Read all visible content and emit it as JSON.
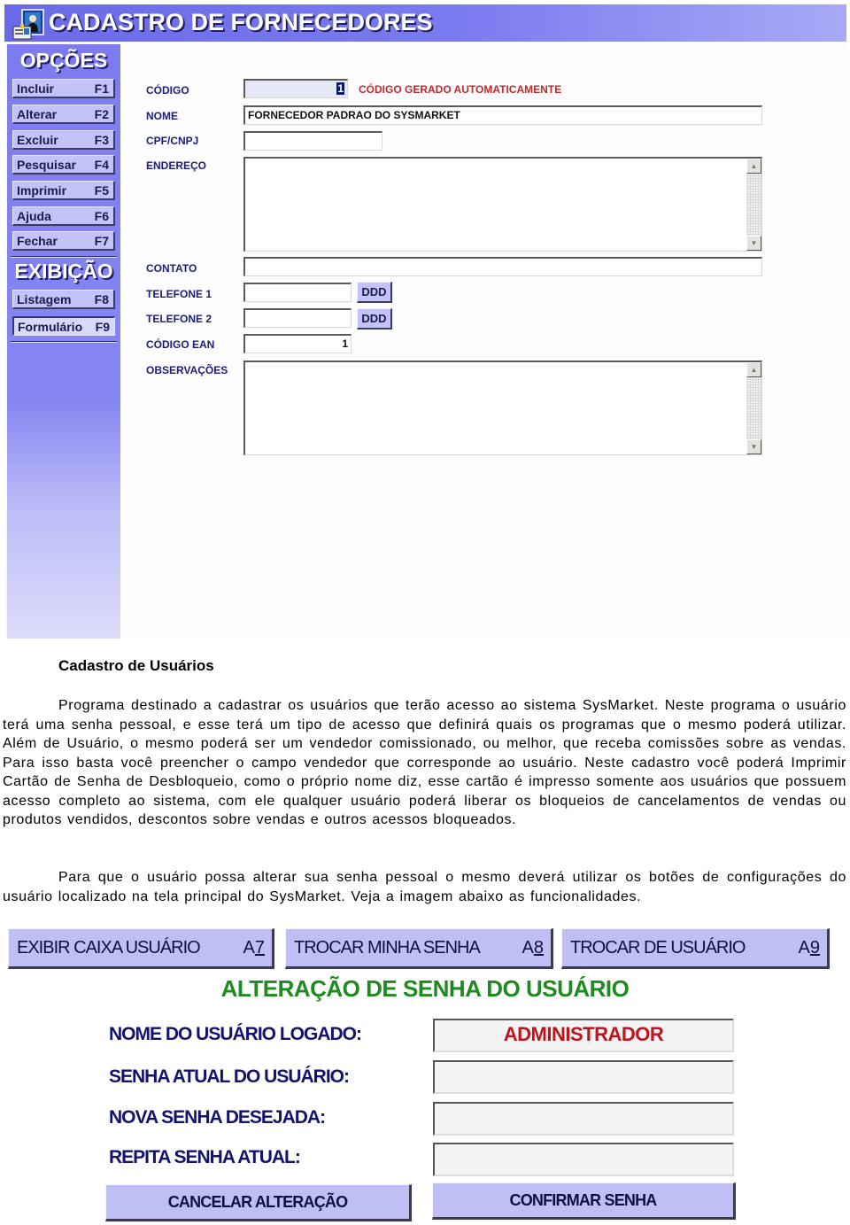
{
  "supplier_form": {
    "title": "CADASTRO DE FORNECEDORES",
    "title_icon": "user-card-icon",
    "sidebar": {
      "options_heading": "OPÇÕES",
      "options": [
        {
          "label": "Incluir",
          "key": "F1"
        },
        {
          "label": "Alterar",
          "key": "F2"
        },
        {
          "label": "Excluir",
          "key": "F3"
        },
        {
          "label": "Pesquisar",
          "key": "F4"
        },
        {
          "label": "Imprimir",
          "key": "F5"
        },
        {
          "label": "Ajuda",
          "key": "F6"
        },
        {
          "label": "Fechar",
          "key": "F7"
        }
      ],
      "display_heading": "EXIBIÇÃO",
      "display": [
        {
          "label": "Listagem",
          "key": "F8"
        },
        {
          "label": "Formulário",
          "key": "F9",
          "pressed": true
        }
      ]
    },
    "fields": {
      "codigo": {
        "label": "CÓDIGO",
        "value": "1",
        "note": "CÓDIGO GERADO AUTOMATICAMENTE"
      },
      "nome": {
        "label": "NOME",
        "value": "FORNECEDOR PADRAO DO SYSMARKET"
      },
      "cpf_cnpj": {
        "label": "CPF/CNPJ",
        "value": ""
      },
      "endereco": {
        "label": "ENDEREÇO",
        "value": ""
      },
      "contato": {
        "label": "CONTATO",
        "value": ""
      },
      "telefone1": {
        "label": "TELEFONE 1",
        "value": "",
        "ddd_label": "DDD"
      },
      "telefone2": {
        "label": "TELEFONE 2",
        "value": "",
        "ddd_label": "DDD"
      },
      "codigo_ean": {
        "label": "CÓDIGO EAN",
        "value": "1"
      },
      "observacoes": {
        "label": "OBSERVAÇÕES",
        "value": ""
      }
    }
  },
  "document": {
    "heading": "Cadastro de Usuários",
    "paragraph1": "Programa destinado a cadastrar os usuários que terão acesso ao sistema SysMarket. Neste programa o usuário terá uma senha pessoal, e esse terá um tipo de acesso que definirá quais os programas que o mesmo poderá utilizar. Além de Usuário, o mesmo poderá ser um vendedor comissionado, ou melhor, que receba comissões sobre as vendas. Para isso basta você preencher o campo vendedor que corresponde ao usuário. Neste cadastro você poderá Imprimir Cartão de Senha de Desbloqueio, como o próprio nome diz, esse cartão é impresso somente aos usuários que possuem acesso completo ao sistema, com ele qualquer usuário poderá liberar os bloqueios de cancelamentos de vendas ou produtos vendidos, descontos sobre vendas e outros acessos bloqueados.",
    "paragraph2": "Para que o usuário possa alterar sua senha pessoal o mesmo deverá utilizar os botões de configurações do usuário localizado na tela principal do SysMarket. Veja a imagem abaixo as funcionalidades."
  },
  "user_buttons": [
    {
      "label": "EXIBIR CAIXA USUÁRIO",
      "key_prefix": "A",
      "key_digit": "7"
    },
    {
      "label": "TROCAR MINHA SENHA",
      "key_prefix": "A",
      "key_digit": "8"
    },
    {
      "label": "TROCAR DE USUÁRIO",
      "key_prefix": "A",
      "key_digit": "9"
    }
  ],
  "password_change": {
    "title": "ALTERAÇÃO DE SENHA DO USUÁRIO",
    "logged_user_label": "NOME DO USUÁRIO LOGADO:",
    "logged_user_value": "ADMINISTRADOR",
    "current_password_label": "SENHA ATUAL DO USUÁRIO:",
    "current_password_value": "",
    "new_password_label": "NOVA SENHA DESEJADA:",
    "new_password_value": "",
    "repeat_password_label": "REPITA SENHA ATUAL:",
    "repeat_password_value": "",
    "cancel_label": "CANCELAR ALTERAÇÃO",
    "confirm_label": "CONFIRMAR SENHA"
  },
  "colors": {
    "title_bar": "#6a6ae8",
    "button_face": "#c3c3fa",
    "label_blue": "#1c1c78",
    "alert_red": "#c0282a",
    "title_green": "#1f8a1f"
  }
}
